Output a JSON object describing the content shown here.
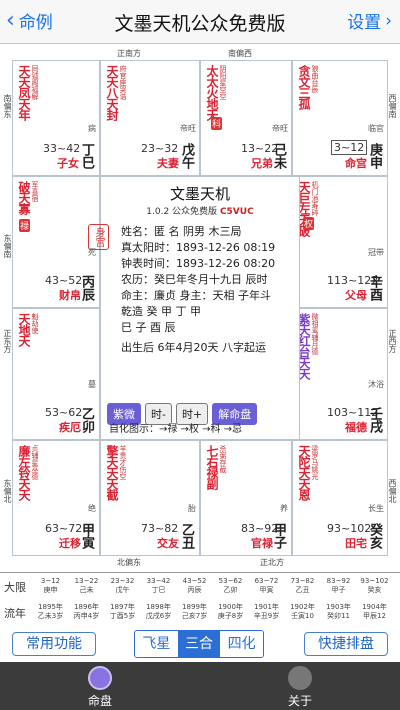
{
  "nav": {
    "back_label": "命例",
    "title": "文墨天机公众免费版",
    "settings_label": "设置"
  },
  "compass": {
    "top_left": "正南方",
    "top_right": "南偏西",
    "left_top": "南偏东",
    "left_mid": "东偏南",
    "left_low": "正东方",
    "left_bottom": "东偏北",
    "right_top": "西偏南",
    "right_mid": "正西方",
    "right_low": "西偏北",
    "bottom_left": "北偏东",
    "bottom_right": "正北方"
  },
  "palaces": [
    {
      "stars": "天天凤天年",
      "minor": "同钺阁福解",
      "range": "33~42",
      "name": "子女",
      "gz": "丁巳",
      "side": "病"
    },
    {
      "stars": "天天八天封",
      "minor": "府官座哭诰",
      "range": "23~32",
      "name": "夫妻",
      "gz": "戊午",
      "side": "帝旺"
    },
    {
      "stars": "太太火地天",
      "minor": "阴阳星空空",
      "range": "13~22",
      "name": "兄弟",
      "gz": "己未",
      "side": "帝旺"
    },
    {
      "stars": "贪文三孤",
      "minor": "狼曲台辰",
      "range": "3~12",
      "name": "命宫",
      "gz": "庚申",
      "side": "临官"
    },
    {
      "stars": "破天寡",
      "minor": "军喜宿",
      "range": "43~52",
      "name": "财帛",
      "gz": "丙辰",
      "side": "死"
    },
    {
      "stars": "天巨左天破",
      "minor": "机门池寿碎",
      "range": "113~122",
      "name": "父母",
      "gz": "辛酉",
      "side": "冠带"
    },
    {
      "stars": "天地天",
      "minor": "魁劫使",
      "range": "53~62",
      "name": "疾厄",
      "gz": "乙卯",
      "side": "墓"
    },
    {
      "stars": "紫天红台天天",
      "minor": "微相鸾辅月德",
      "range": "103~112",
      "name": "福德",
      "gz": "壬戌",
      "side": "沐浴"
    },
    {
      "stars": "廉左铃天天",
      "minor": "贞辅星巫德",
      "range": "63~72",
      "name": "迁移",
      "gz": "甲寅",
      "side": "绝"
    },
    {
      "stars": "擎天天天截",
      "minor": "羊贵才伤空",
      "range": "73~82",
      "name": "交友",
      "gz": "乙丑",
      "side": "胎"
    },
    {
      "stars": "七右禄副",
      "minor": "杀弼存截",
      "range": "83~92",
      "name": "官禄",
      "gz": "甲子",
      "side": "养"
    },
    {
      "stars": "天陀天天恩",
      "minor": "梁罗马姚光",
      "range": "93~102",
      "name": "田宅",
      "gz": "癸亥",
      "side": "长生"
    }
  ],
  "center": {
    "title": "文墨天机",
    "version": "1.0.2 公众免费版",
    "code": "C5VUC",
    "name_line": "姓名：匿 名    阴男 木三局",
    "solar_line": "真太阳时：1893-12-26 08:19",
    "clock_line": "钟表时间：1893-12-26 08:20",
    "lunar_line": "农历：癸巳年冬月十九日 辰时",
    "master_line": "命主：廉贞  身主：天相  子年斗",
    "qz_line": "乾造 癸   甲   丁   甲",
    "zhi_line": "       巳   子   酉   辰",
    "age_line": "出生后 6年4月20天 八字起运",
    "btn_ziwei": "紫微",
    "btn_time_minus": "时-",
    "btn_time_plus": "时+",
    "btn_explain": "解命盘",
    "legend": "自化图示：→禄 →权 →科 →忌",
    "stamp_left": "身宫"
  },
  "dayun": {
    "label": "大限",
    "items": [
      "3~12\n庚申",
      "13~22\n己未",
      "23~32\n戊午",
      "33~42\n丁巳",
      "43~52\n丙辰",
      "53~62\n乙卯",
      "63~72\n甲寅",
      "73~82\n乙丑",
      "83~92\n甲子",
      "93~102\n癸亥"
    ]
  },
  "liunian": {
    "label": "流年",
    "items": [
      "1895年\n乙未3岁",
      "1896年\n丙申4岁",
      "1897年\n丁酉5岁",
      "1898年\n戊戌6岁",
      "1899年\n己亥7岁",
      "1900年\n庚子8岁",
      "1901年\n辛丑9岁",
      "1902年\n壬寅10",
      "1903年\n癸卯11",
      "1904年\n甲辰12"
    ]
  },
  "toolbar": {
    "left_btn": "常用功能",
    "seg1": "飞星",
    "seg2": "三合",
    "seg3": "四化",
    "right_btn": "快捷排盘"
  },
  "tabs": {
    "tab1": "命盘",
    "tab2": "关于"
  }
}
